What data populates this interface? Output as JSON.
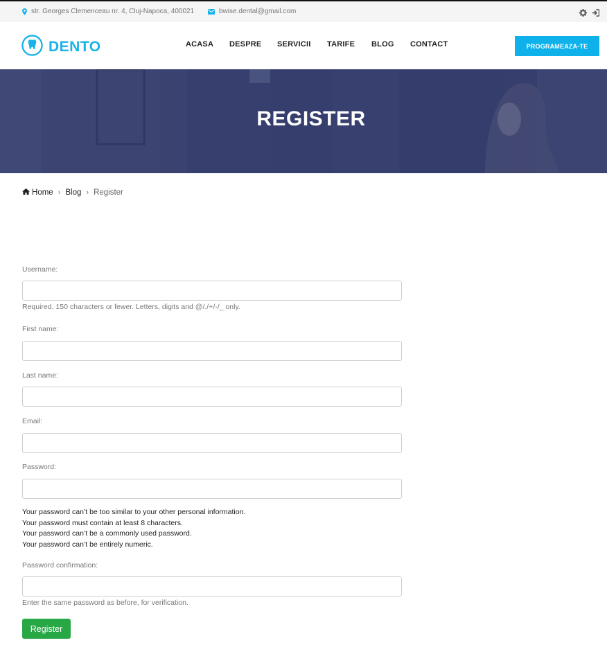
{
  "topbar": {
    "address": "str. Georges Clemenceau nr. 4, Cluj-Napoca, 400021",
    "email": "bwise.dental@gmail.com"
  },
  "header": {
    "logo_text": "DENTO",
    "nav": [
      "ACASA",
      "DESPRE",
      "SERVICII",
      "TARIFE",
      "BLOG",
      "CONTACT"
    ],
    "cta_label": "PROGRAMEAZA-TE"
  },
  "hero": {
    "title": "REGISTER"
  },
  "breadcrumb": {
    "home": "Home",
    "blog": "Blog",
    "current": "Register"
  },
  "form": {
    "username_label": "Username:",
    "username_help": "Required. 150 characters or fewer. Letters, digits and @/./+/-/_ only.",
    "first_name_label": "First name:",
    "last_name_label": "Last name:",
    "email_label": "Email:",
    "password_label": "Password:",
    "password_rules": [
      "Your password can’t be too similar to your other personal information.",
      "Your password must contain at least 8 characters.",
      "Your password can’t be a commonly used password.",
      "Your password can’t be entirely numeric."
    ],
    "password_confirm_label": "Password confirmation:",
    "password_confirm_help": "Enter the same password as before, for verification.",
    "submit_label": "Register"
  },
  "colors": {
    "brand": "#1ab2e8",
    "cta": "#0fb1eb",
    "submit": "#28a745",
    "hero": "#3a4068"
  }
}
